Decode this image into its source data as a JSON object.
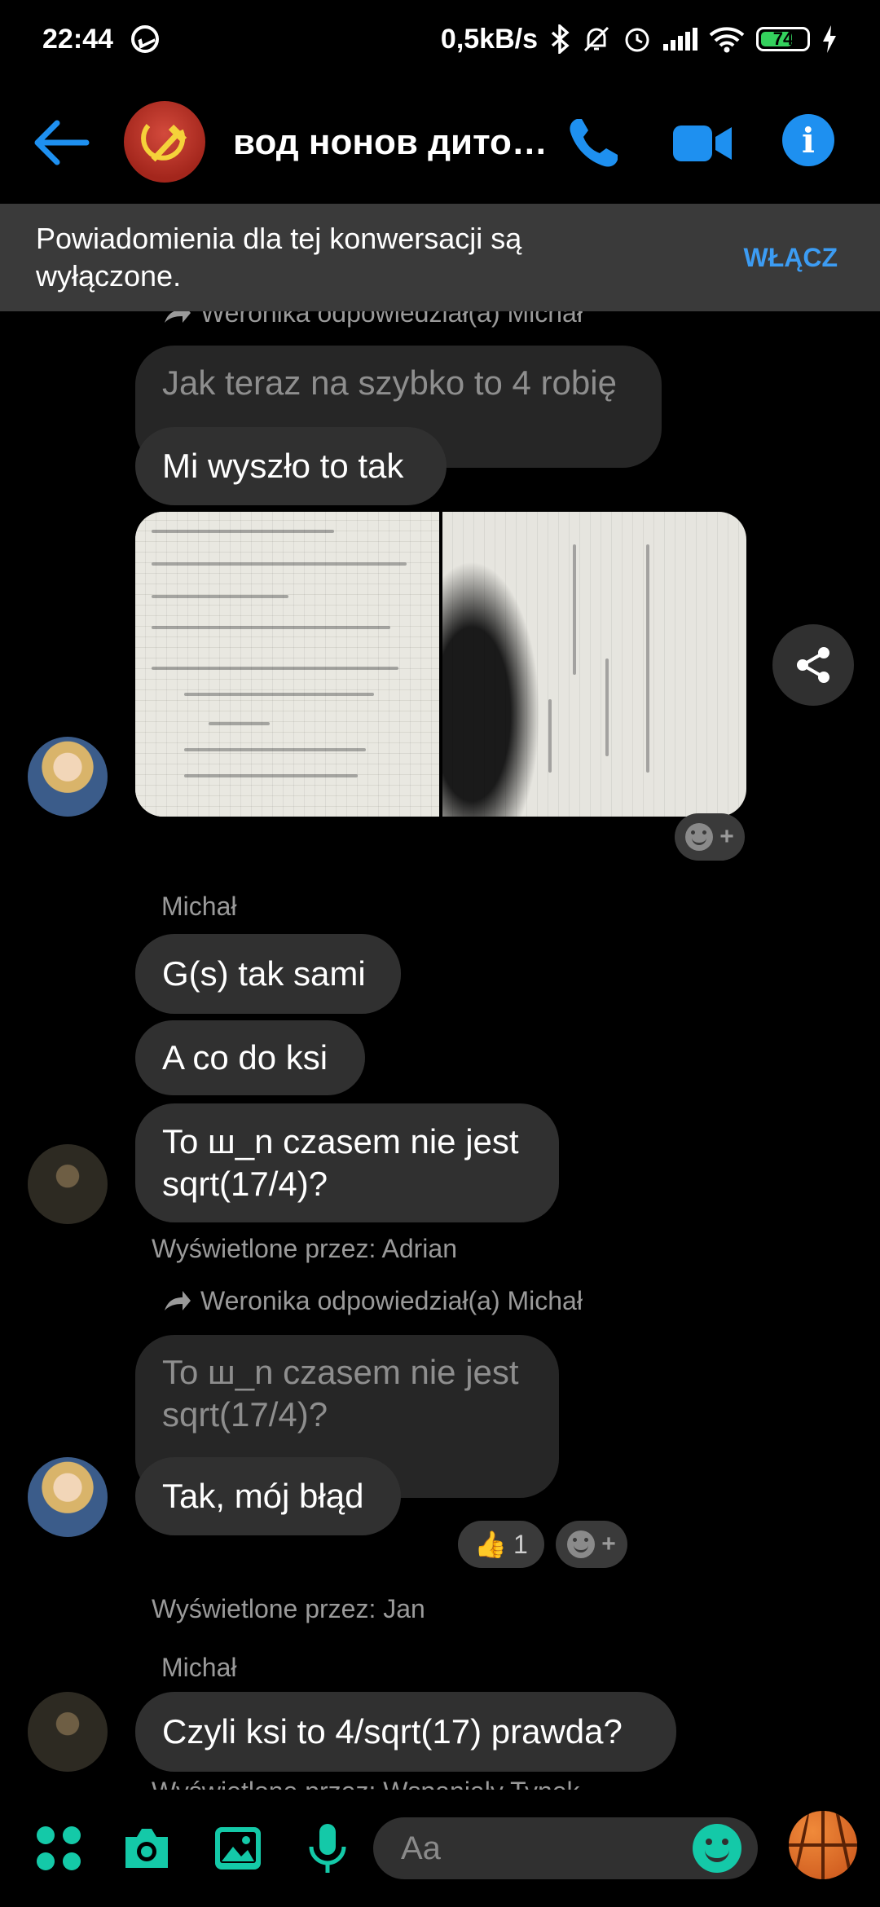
{
  "status_bar": {
    "time": "22:44",
    "network_speed": "0,5kB/s",
    "battery": "74",
    "battery_level": 0.74
  },
  "header": {
    "title": "вод нонов дито…",
    "back_icon": "arrow-left-icon",
    "call_icon": "phone-icon",
    "video_icon": "video-camera-icon",
    "info_icon": "info-icon",
    "info_glyph": "i",
    "accent": "#1e90f0"
  },
  "banner": {
    "text": "Powiadomienia dla tej konwersacji są wyłączone.",
    "action": "WŁĄCZ"
  },
  "messages": {
    "reply1": "Weronika odpowiedział(a) Michał",
    "quoted1": "Jak teraz na szybko to 4 robię",
    "msg1": "Mi wyszło to tak",
    "sender2": "Michał",
    "msg2": "G(s) tak sami",
    "msg3": "A co do ksi",
    "msg4": "To ш_n czasem nie jest sqrt(17/4)?",
    "seen1": "Wyświetlone przez: Adrian",
    "reply2": "Weronika odpowiedział(a) Michał",
    "quoted2": "To ш_n czasem nie jest sqrt(17/4)?",
    "msg5": "Tak, mój błąd",
    "reaction_emoji": "👍",
    "reaction_count": "1",
    "seen2": "Wyświetlone przez: Jan",
    "sender3": "Michał",
    "msg6": "Czyli ksi to 4/sqrt(17) prawda?",
    "seen3": "Wyświetlone przez: Wspaniały Tynek"
  },
  "composer": {
    "placeholder": "Aa",
    "icons": [
      "apps-icon",
      "camera-icon",
      "gallery-icon",
      "microphone-icon",
      "emoji-icon",
      "basketball-icon"
    ],
    "accent": "#14c9a8"
  }
}
